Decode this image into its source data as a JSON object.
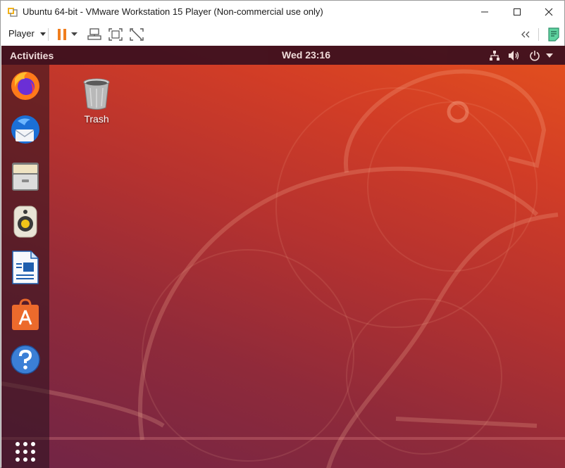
{
  "window": {
    "title": "Ubuntu 64-bit - VMware Workstation 15 Player (Non-commercial use only)",
    "controls": {
      "minimize_icon": "minimize-icon",
      "maximize_icon": "maximize-icon",
      "close_icon": "close-icon"
    }
  },
  "toolbar": {
    "player_label": "Player",
    "icons": [
      "pause-icon",
      "dropdown-icon",
      "send-ctrl-alt-del-icon",
      "fullscreen-icon",
      "unity-icon",
      "collapse-toolbar-icon",
      "notes-icon"
    ]
  },
  "guest": {
    "topbar": {
      "activities_label": "Activities",
      "clock": "Wed 23:16",
      "tray_icons": [
        "network-icon",
        "volume-icon",
        "power-icon",
        "menu-caret-icon"
      ]
    },
    "dock": {
      "items": [
        "firefox-icon",
        "thunderbird-icon",
        "files-icon",
        "rhythmbox-icon",
        "libreoffice-writer-icon",
        "ubuntu-software-icon",
        "help-icon"
      ],
      "show_apps_icon": "show-applications-icon"
    },
    "desktop": {
      "icons": [
        {
          "label": "Trash",
          "icon": "trash-icon"
        }
      ]
    }
  },
  "colors": {
    "wallpaper_top": "#e4511e",
    "wallpaper_bottom": "#6f2446",
    "topbar": "#3a0f1e",
    "pause_orange": "#f07e1e"
  }
}
